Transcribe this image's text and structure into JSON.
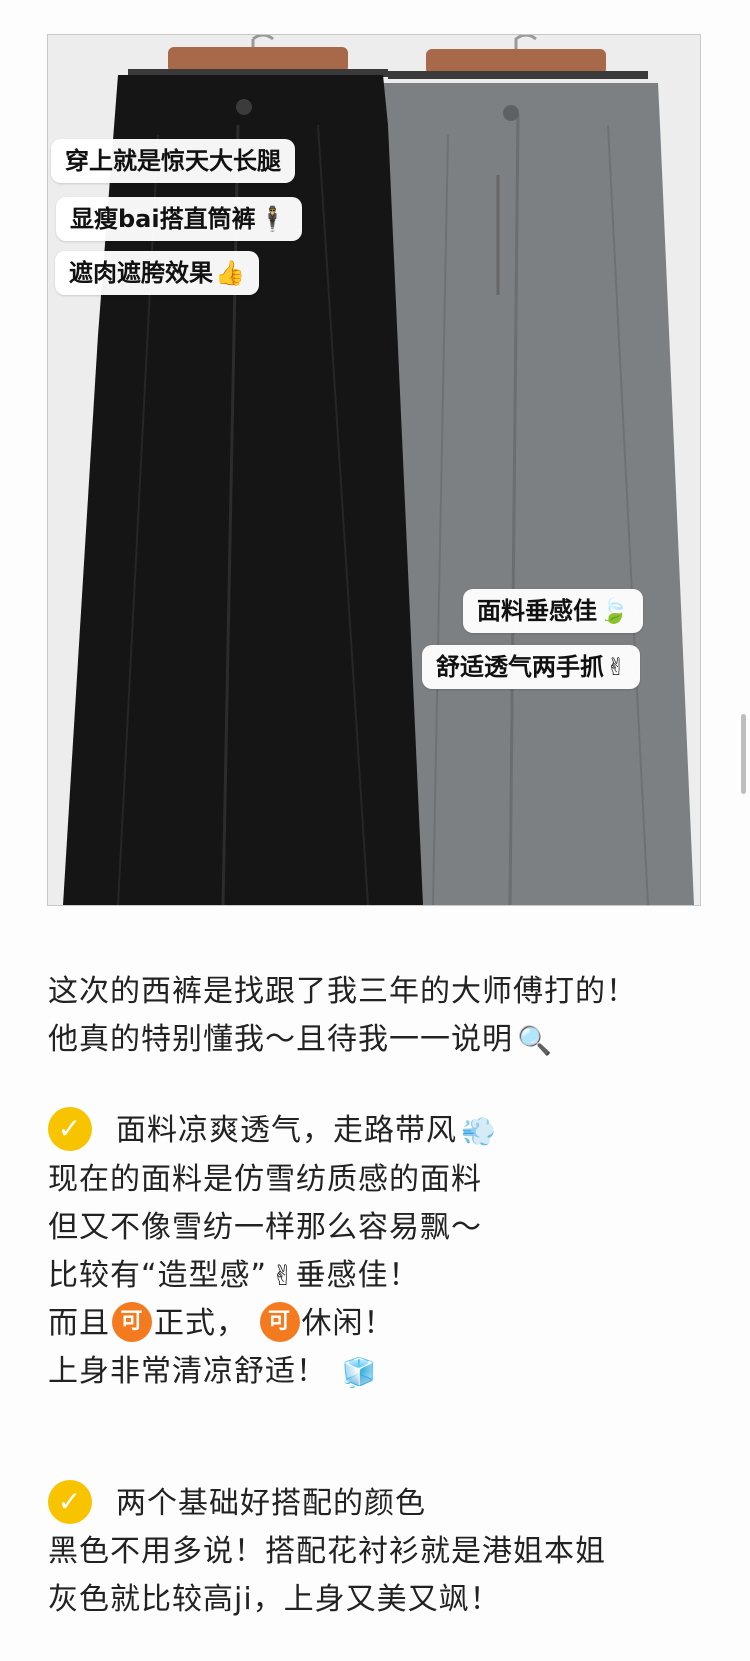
{
  "photo": {
    "tags_left": [
      {
        "text": "穿上就是惊天大长腿",
        "emoji": ""
      },
      {
        "text": "显瘦bai搭直筒裤",
        "emoji": "🕴"
      },
      {
        "text": "遮肉遮胯效果",
        "emoji": "👍"
      }
    ],
    "tags_right": [
      {
        "text": "面料垂感佳",
        "emoji": "🍃"
      },
      {
        "text": "舒适透气两手抓",
        "emoji": "✌"
      }
    ]
  },
  "intro": {
    "line1": "这次的西裤是找跟了我三年的大师傅打的！",
    "line2": "他真的特别懂我～且待我一一说明",
    "line2_emoji": "🔍"
  },
  "section1": {
    "check_icon": "✓",
    "heading": "面料凉爽透气，走路带风",
    "heading_emoji": "💨",
    "line1": "现在的面料是仿雪纺质感的面料",
    "line2": "但又不像雪纺一样那么容易飘～",
    "line3_a": "比较有“造型感”",
    "line3_emoji": "✌",
    "line3_b": "垂感佳！",
    "line4_a": "而且",
    "ke_label": "可",
    "line4_b": "正式，",
    "line4_c": "休闲！",
    "line5": "上身非常清凉舒适！",
    "line5_emoji": "🧊"
  },
  "section2": {
    "check_icon": "✓",
    "heading": "两个基础好搭配的颜色",
    "line1": "黑色不用多说！搭配花衬衫就是港姐本姐",
    "line2": "灰色就比较高ji，上身又美又飒！"
  },
  "colors": {
    "check_yellow": "#f8c400",
    "ke_orange": "#f47a20",
    "black_pants": "#151515",
    "grey_pants": "#7d8083"
  }
}
